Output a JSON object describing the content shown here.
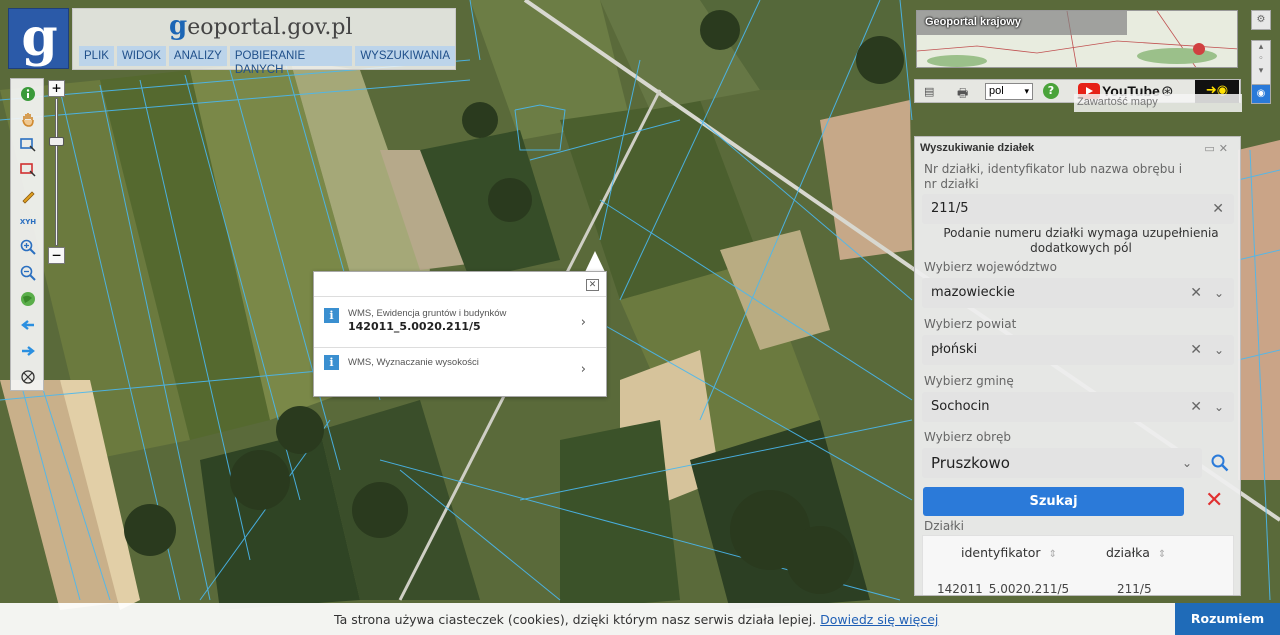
{
  "header": {
    "logo_letter": "g",
    "title_prefix": "g",
    "title_rest": "eoportal.gov.pl",
    "menu": [
      "PLIK",
      "WIDOK",
      "ANALIZY",
      "POBIERANIE DANYCH",
      "WYSZUKIWANIA"
    ]
  },
  "left_toolbar": {
    "tools": [
      {
        "icon": "info-icon",
        "color": "#3a9a3a"
      },
      {
        "icon": "hand-pan-icon",
        "color": "#d08a30"
      },
      {
        "icon": "select-rectangle-icon",
        "color": "#2a6fc0"
      },
      {
        "icon": "select-remove-icon",
        "color": "#d03030"
      },
      {
        "icon": "pencil-icon",
        "color": "#d09a20"
      },
      {
        "icon": "xyh-coordinates-icon",
        "color": "#2a6fc0",
        "text": "XYH"
      },
      {
        "icon": "zoom-in-icon",
        "color": "#2a6fc0"
      },
      {
        "icon": "zoom-out-icon",
        "color": "#2a6fc0"
      },
      {
        "icon": "globe-icon",
        "color": "#3a9a3a"
      },
      {
        "icon": "arrow-back-icon",
        "color": "#2a8fe0"
      },
      {
        "icon": "arrow-forward-icon",
        "color": "#2a8fe0"
      },
      {
        "icon": "crosshair-icon",
        "color": "#333"
      }
    ]
  },
  "zoom": {
    "plus": "+",
    "minus": "−"
  },
  "popup": {
    "rows": [
      {
        "layer": "WMS, Ewidencja gruntów i budynków",
        "value": "142011_5.0020.211/5"
      },
      {
        "layer": "WMS, Wyznaczanie wysokości",
        "value": ""
      }
    ],
    "close": "✕"
  },
  "overview": {
    "title": "Geoportal krajowy"
  },
  "toolbar2": {
    "lang": "pol",
    "youtube": "YouTube"
  },
  "content_map_label": "Zawartość mapy",
  "search_panel": {
    "title": "Wyszukiwanie działek",
    "field_label": "Nr działki, identyfikator lub nazwa obrębu i nr działki",
    "field_value": "211/5",
    "note": "Podanie numeru działki wymaga uzupełnienia dodatkowych pól",
    "voivodeship_label": "Wybierz województwo",
    "voivodeship_value": "mazowieckie",
    "county_label": "Wybierz powiat",
    "county_value": "płoński",
    "commune_label": "Wybierz gminę",
    "commune_value": "Sochocin",
    "precinct_label": "Wybierz obręb",
    "precinct_value": "Pruszkowo",
    "search_button": "Szukaj",
    "results_label": "Działki",
    "col_id": "identyfikator",
    "col_plot": "działka",
    "row_id": "142011_5.0020.211/5",
    "row_plot": "211/5"
  },
  "cookie": {
    "text": "Ta strona używa ciasteczek (cookies), dzięki którym nasz serwis działa lepiej.",
    "link": "Dowiedz się więcej",
    "button": "Rozumiem"
  }
}
